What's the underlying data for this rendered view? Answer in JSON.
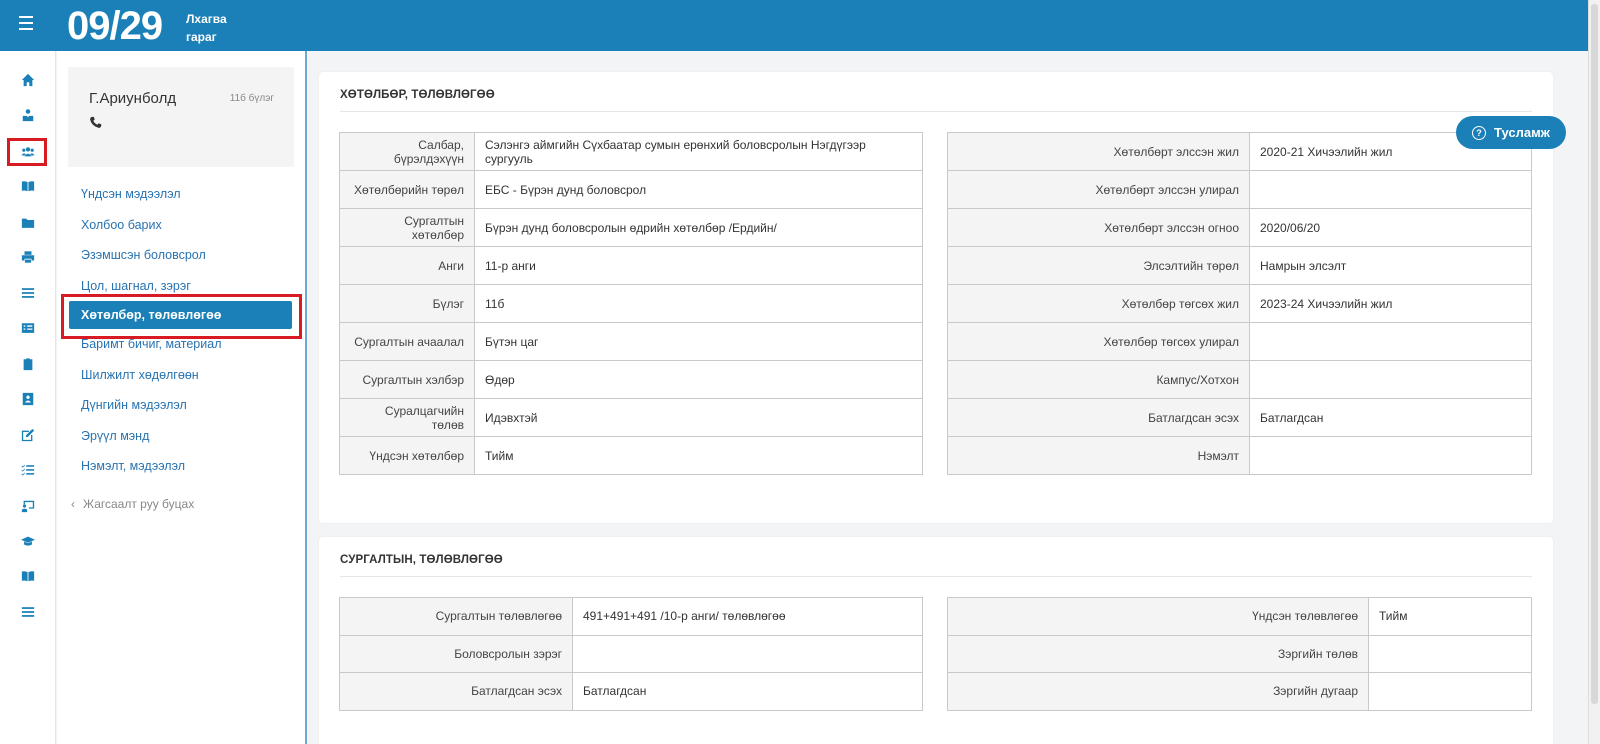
{
  "header": {
    "date": "09/29",
    "day_line1": "Лхагва",
    "day_line2": "гараг"
  },
  "rail": {
    "icons": [
      "home-icon",
      "user-hand-icon",
      "users-icon",
      "book-open-icon",
      "folder-icon",
      "print-icon",
      "list-icon",
      "id-card-icon",
      "clipboard-icon",
      "contact-card-icon",
      "edit-icon",
      "checklist-icon",
      "chalkboard-icon",
      "graduation-cap-icon",
      "book-icon",
      "menu-lines-icon"
    ],
    "active_icon": "users-icon",
    "accent_color": "#1b80b8",
    "highlight_color": "#d81b23"
  },
  "profile": {
    "name": "Г.Ариунболд",
    "group": "11б бүлэг"
  },
  "menu": {
    "items": [
      {
        "label": "Үндсэн мэдээлэл"
      },
      {
        "label": "Холбоо барих"
      },
      {
        "label": "Эзэмшсэн боловсрол"
      },
      {
        "label": "Цол, шагнал, зэрэг"
      },
      {
        "label": "Хөтөлбөр, төлөвлөгөө"
      },
      {
        "label": "Баримт бичиг, материал"
      },
      {
        "label": "Шилжилт хөдөлгөөн"
      },
      {
        "label": "Дүнгийн мэдээлэл"
      },
      {
        "label": "Эрүүл мэнд"
      },
      {
        "label": "Нэмэлт, мэдээлэл"
      }
    ],
    "active_index": 4,
    "back_label": "Жагсаалт руу буцах"
  },
  "help": {
    "label": "Тусламж"
  },
  "program": {
    "title": "ХӨТӨЛБӨР, ТӨЛӨВЛӨГӨӨ",
    "left": [
      {
        "key": "Салбар, бүрэлдэхүүн",
        "value": "Сэлэнгэ аймгийн Сүхбаатар сумын ерөнхий боловсролын Нэгдүгээр сургууль"
      },
      {
        "key": "Хөтөлбөрийн төрөл",
        "value": "ЕБС - Бүрэн дунд боловсрол"
      },
      {
        "key": "Сургалтын хөтөлбөр",
        "value": "Бүрэн дунд боловсролын өдрийн хөтөлбөр /Ердийн/"
      },
      {
        "key": "Анги",
        "value": "11-р анги"
      },
      {
        "key": "Бүлэг",
        "value": "11б"
      },
      {
        "key": "Сургалтын ачаалал",
        "value": "Бүтэн цаг"
      },
      {
        "key": "Сургалтын хэлбэр",
        "value": "Өдөр"
      },
      {
        "key": "Суралцагчийн төлөв",
        "value": "Идэвхтэй"
      },
      {
        "key": "Үндсэн хөтөлбөр",
        "value": "Тийм"
      }
    ],
    "right": [
      {
        "key": "Хөтөлбөрт элссэн жил",
        "value": "2020-21 Хичээлийн жил"
      },
      {
        "key": "Хөтөлбөрт элссэн улирал",
        "value": ""
      },
      {
        "key": "Хөтөлбөрт элссэн огноо",
        "value": "2020/06/20"
      },
      {
        "key": "Элсэлтийн төрөл",
        "value": "Намрын элсэлт"
      },
      {
        "key": "Хөтөлбөр төгсөх жил",
        "value": "2023-24 Хичээлийн жил"
      },
      {
        "key": "Хөтөлбөр төгсөх улирал",
        "value": ""
      },
      {
        "key": "Кампус/Хотхон",
        "value": ""
      },
      {
        "key": "Батлагдсан эсэх",
        "value": "Батлагдсан"
      },
      {
        "key": "Нэмэлт",
        "value": ""
      }
    ]
  },
  "training": {
    "title": "СУРГАЛТЫН, ТӨЛӨВЛӨГӨӨ",
    "left": [
      {
        "key": "Сургалтын төлөвлөгөө",
        "value": "491+491+491 /10-р анги/ төлөвлөгөө"
      },
      {
        "key": "Боловсролын зэрэг",
        "value": ""
      },
      {
        "key": "Батлагдсан эсэх",
        "value": "Батлагдсан"
      }
    ],
    "right": [
      {
        "key": "Үндсэн төлөвлөгөө",
        "value": "Тийм"
      },
      {
        "key": "Зэргийн төлөв",
        "value": ""
      },
      {
        "key": "Зэргийн дугаар",
        "value": ""
      }
    ]
  }
}
